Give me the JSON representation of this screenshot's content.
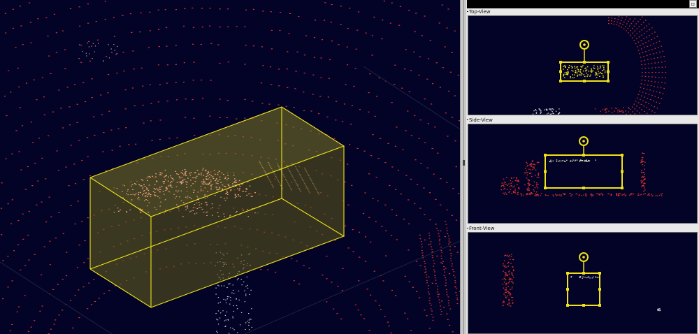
{
  "panel": {
    "restore_label": "▫",
    "top_view_title": "Top-View",
    "side_view_title": "Side-View",
    "front_view_title": "Front-View"
  },
  "icons": {
    "restore": "restore-window-icon",
    "rotate_handle": "rotate-handle-icon"
  },
  "colors": {
    "background": "#030327",
    "point_cloud": "#d8342a",
    "object_points": "#f2a17f",
    "bbox": "#f0e218",
    "bbox_fill": "#6f6a1c",
    "panel_bg": "#e8e8e8"
  }
}
